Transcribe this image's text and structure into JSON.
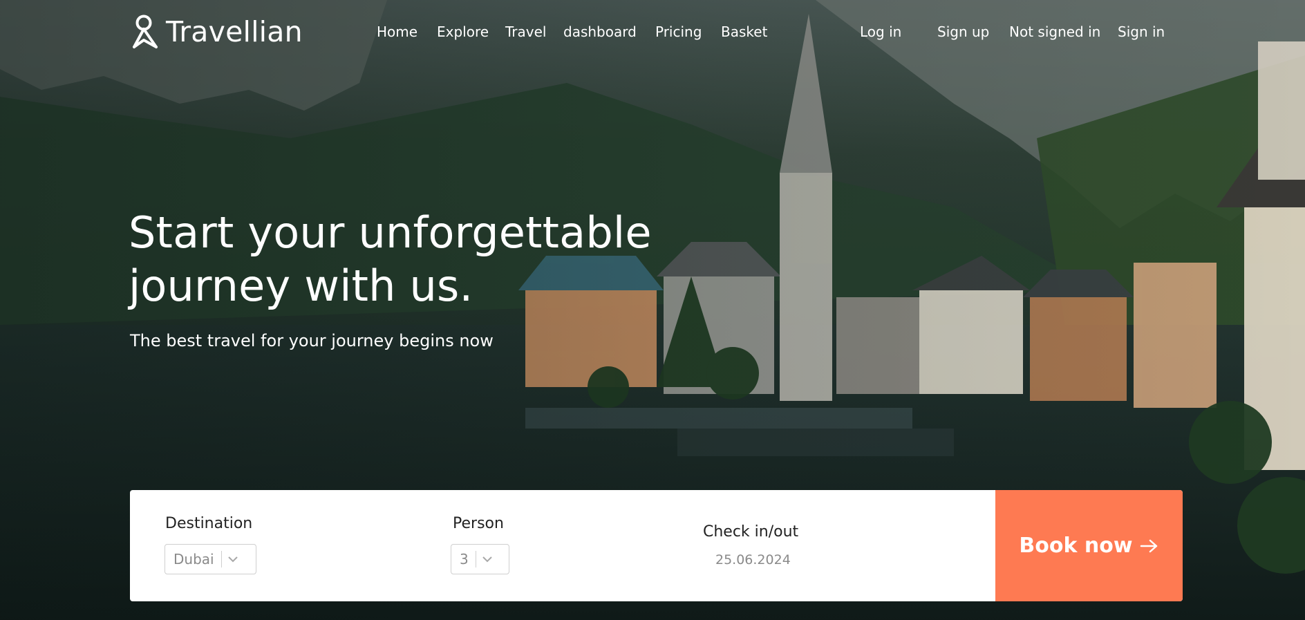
{
  "brand": {
    "name": "Travellian",
    "logo_icon": "person-pin-icon"
  },
  "nav": {
    "items": [
      "Home",
      "Explore",
      "Travel",
      "dashboard",
      "Pricing",
      "Basket"
    ]
  },
  "auth": {
    "login": "Log in",
    "signup": "Sign up",
    "status": "Not signed in",
    "signin": "Sign in"
  },
  "hero": {
    "headline_line1": "Start your unforgettable",
    "headline_line2": "journey with us.",
    "subheading": "The best travel for your journey begins now"
  },
  "booking": {
    "destination_label": "Destination",
    "destination_value": "Dubai",
    "person_label": "Person",
    "person_value": "3",
    "check_label": "Check in/out",
    "check_value": "25.06.2024",
    "book_label": "Book now",
    "book_icon": "arrow-right-icon"
  },
  "colors": {
    "accent": "#fe7a52",
    "text_light": "#ffffff",
    "panel": "#ffffff"
  }
}
